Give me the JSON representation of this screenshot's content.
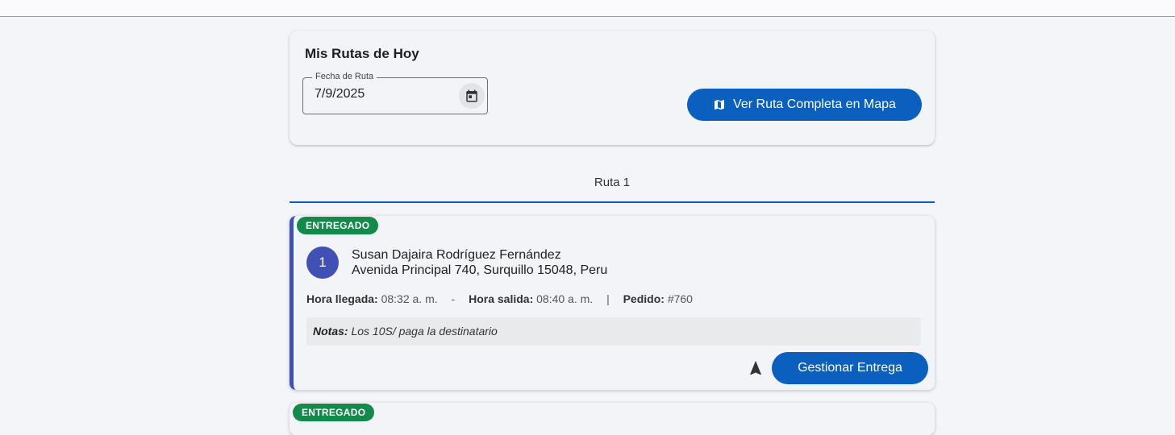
{
  "header": {
    "title": "Mis Rutas de Hoy"
  },
  "date_filter": {
    "label": "Fecha de Ruta",
    "value": "7/9/2025"
  },
  "map_button": {
    "label": "Ver Ruta Completa en Mapa"
  },
  "tabs": [
    {
      "label": "Ruta 1",
      "selected": true
    }
  ],
  "stops": [
    {
      "status": "ENTREGADO",
      "order": "1",
      "name": "Susan Dajaira Rodríguez Fernández",
      "address": "Avenida Principal 740, Surquillo 15048, Peru",
      "arrival_label": "Hora llegada:",
      "arrival_time": "08:32 a. m.",
      "sep1": "-",
      "departure_label": "Hora salida:",
      "departure_time": "08:40 a. m.",
      "sep2": "|",
      "order_label": "Pedido:",
      "order_id": "#760",
      "notes_label": "Notas:",
      "notes": "Los 10S/ paga la destinatario",
      "action_label": "Gestionar Entrega"
    },
    {
      "status": "ENTREGADO"
    }
  ],
  "colors": {
    "primary": "#0a5fbf",
    "accent": "#3f51b5",
    "status_delivered": "#118a4a",
    "background": "#f4f5f8"
  },
  "icons": {
    "map_button": "map-icon",
    "date_picker": "calendar-icon",
    "navigate": "navigation-arrow-icon"
  }
}
